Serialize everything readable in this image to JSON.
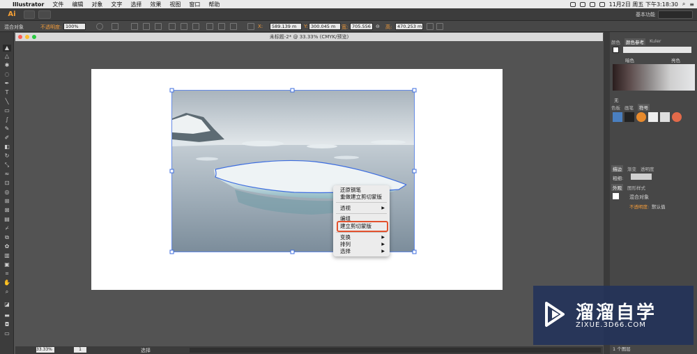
{
  "menubar": {
    "app": "Illustrator",
    "items": [
      "文件",
      "编辑",
      "对象",
      "文字",
      "选择",
      "效果",
      "视图",
      "窗口",
      "帮助"
    ],
    "clock": "11月2日 周五 下午3:18:30"
  },
  "appbar": {
    "logo": "Ai",
    "workspace": "基本功能"
  },
  "control": {
    "selection_type": "混合对象",
    "opacity_label": "不透明度:",
    "opacity_value": "100%",
    "x_label": "X:",
    "x_value": "589.139 m",
    "y_label": "Y:",
    "y_value": "300.045 m",
    "w_label": "宽:",
    "w_value": "705.556 m",
    "h_label": "高:",
    "h_value": "470.253 m"
  },
  "document": {
    "title": "未标题-2* @ 33.33% (CMYK/预览)",
    "zoom": "33.33%",
    "status_text": "选择",
    "page_num": "1"
  },
  "context_menu": {
    "items": [
      {
        "label": "还原钢笔",
        "submenu": false
      },
      {
        "label": "重做建立剪切蒙版",
        "submenu": false
      },
      {
        "label": "透视",
        "submenu": true
      },
      {
        "label": "编组",
        "submenu": false
      },
      {
        "label": "建立剪切蒙版",
        "submenu": false,
        "highlighted": true
      },
      {
        "label": "变换",
        "submenu": true
      },
      {
        "label": "排列",
        "submenu": true
      },
      {
        "label": "选择",
        "submenu": true
      }
    ]
  },
  "panels": {
    "swatches_tabs": [
      "颜色",
      "颜色参考",
      "Kuler"
    ],
    "harmony_left": "暗色",
    "harmony_right": "亮色",
    "stroke_none": "无",
    "libraries_tabs": [
      "色板",
      "画笔",
      "符号"
    ],
    "stroke_tabs": [
      "描边",
      "渐变",
      "透明度"
    ],
    "weight_label": "粗细:",
    "appearance_tabs": [
      "外观",
      "图形样式"
    ],
    "appearance_object": "混合对象",
    "appearance_opacity_label": "不透明度:",
    "appearance_opacity_value": "默认值",
    "layers_count": "1 个图层"
  },
  "watermark": {
    "title": "溜溜自学",
    "url": "ZIXUE.3D66.COM"
  },
  "colors": {
    "accent_orange": "#f29b3a",
    "highlight_red": "#e2522e",
    "selection_blue": "#3d6ddf"
  }
}
